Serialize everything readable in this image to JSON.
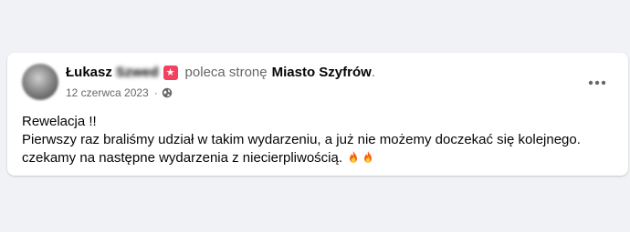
{
  "post": {
    "author_first": "Łukasz",
    "author_last": "Szwed",
    "verb": "poleca stronę",
    "page_name": "Miasto Szyfrów",
    "punct": ".",
    "date": "12 czerwca 2023",
    "separator": "·",
    "privacy_icon": "globe-icon",
    "recommend_icon": "star-badge-icon",
    "more_icon": "more-dots-icon",
    "lines": [
      "Rewelacja !!",
      "Pierwszy raz braliśmy udział w takim wydarzeniu, a już nie możemy doczekać się kolejnego.",
      "czekamy na następne wydarzenia z niecierpliwością."
    ],
    "emoji": [
      "🔥",
      "🔥"
    ],
    "colors": {
      "background": "#f0f2f5",
      "card": "#ffffff",
      "text": "#050505",
      "secondary": "#65676b",
      "badge": "#f3425f"
    }
  }
}
